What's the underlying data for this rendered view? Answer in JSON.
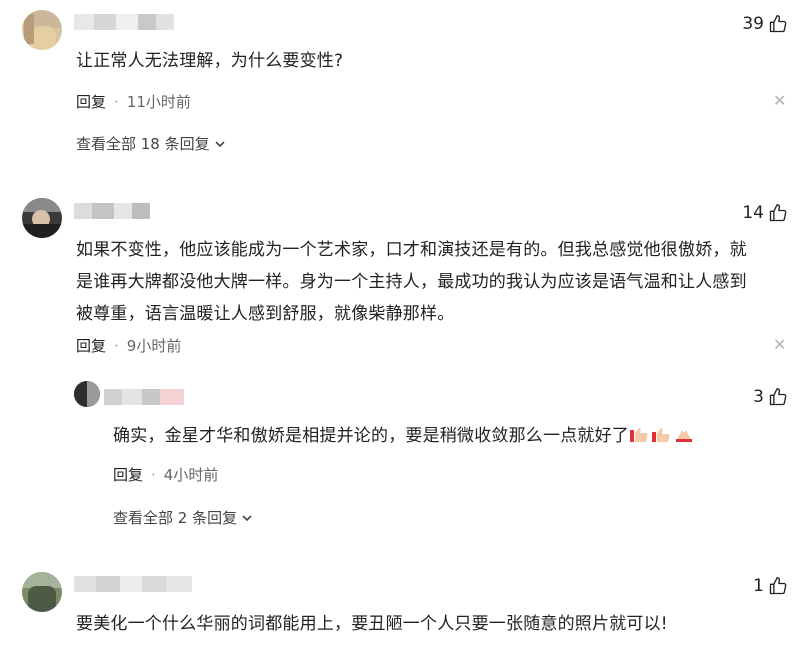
{
  "icons": {
    "like": "thumbs-up-icon",
    "close": "close-icon",
    "expand": "chevron-down-icon"
  },
  "colors": {
    "text": "#222222",
    "meta": "#666666",
    "close": "#b3b3b3"
  },
  "comments": [
    {
      "likes": "39",
      "text": "让正常人无法理解，为什么要变性?",
      "reply_label": "回复",
      "time": "11小时前",
      "view_all": "查看全部 18 条回复"
    },
    {
      "likes": "14",
      "text_lines": [
        "如果不变性，他应该能成为一个艺术家，口才和演技还是有的。但我总感觉他很傲娇，就",
        "是谁再大牌都没他大牌一样。身为一个主持人，最成功的我认为应该是语气温和让人感到",
        "被尊重，语言温暖让人感到舒服，就像柴静那样。"
      ],
      "reply_label": "回复",
      "time": "9小时前",
      "reply": {
        "likes": "3",
        "text": "确实，金星才华和傲娇是相提并论的，要是稍微收敛那么一点就好了",
        "reply_label": "回复",
        "time": "4小时前",
        "view_all": "查看全部 2 条回复"
      }
    },
    {
      "likes": "1",
      "text": "要美化一个什么华丽的词都能用上，要丑陋一个人只要一张随意的照片就可以!"
    }
  ],
  "separator": "·"
}
